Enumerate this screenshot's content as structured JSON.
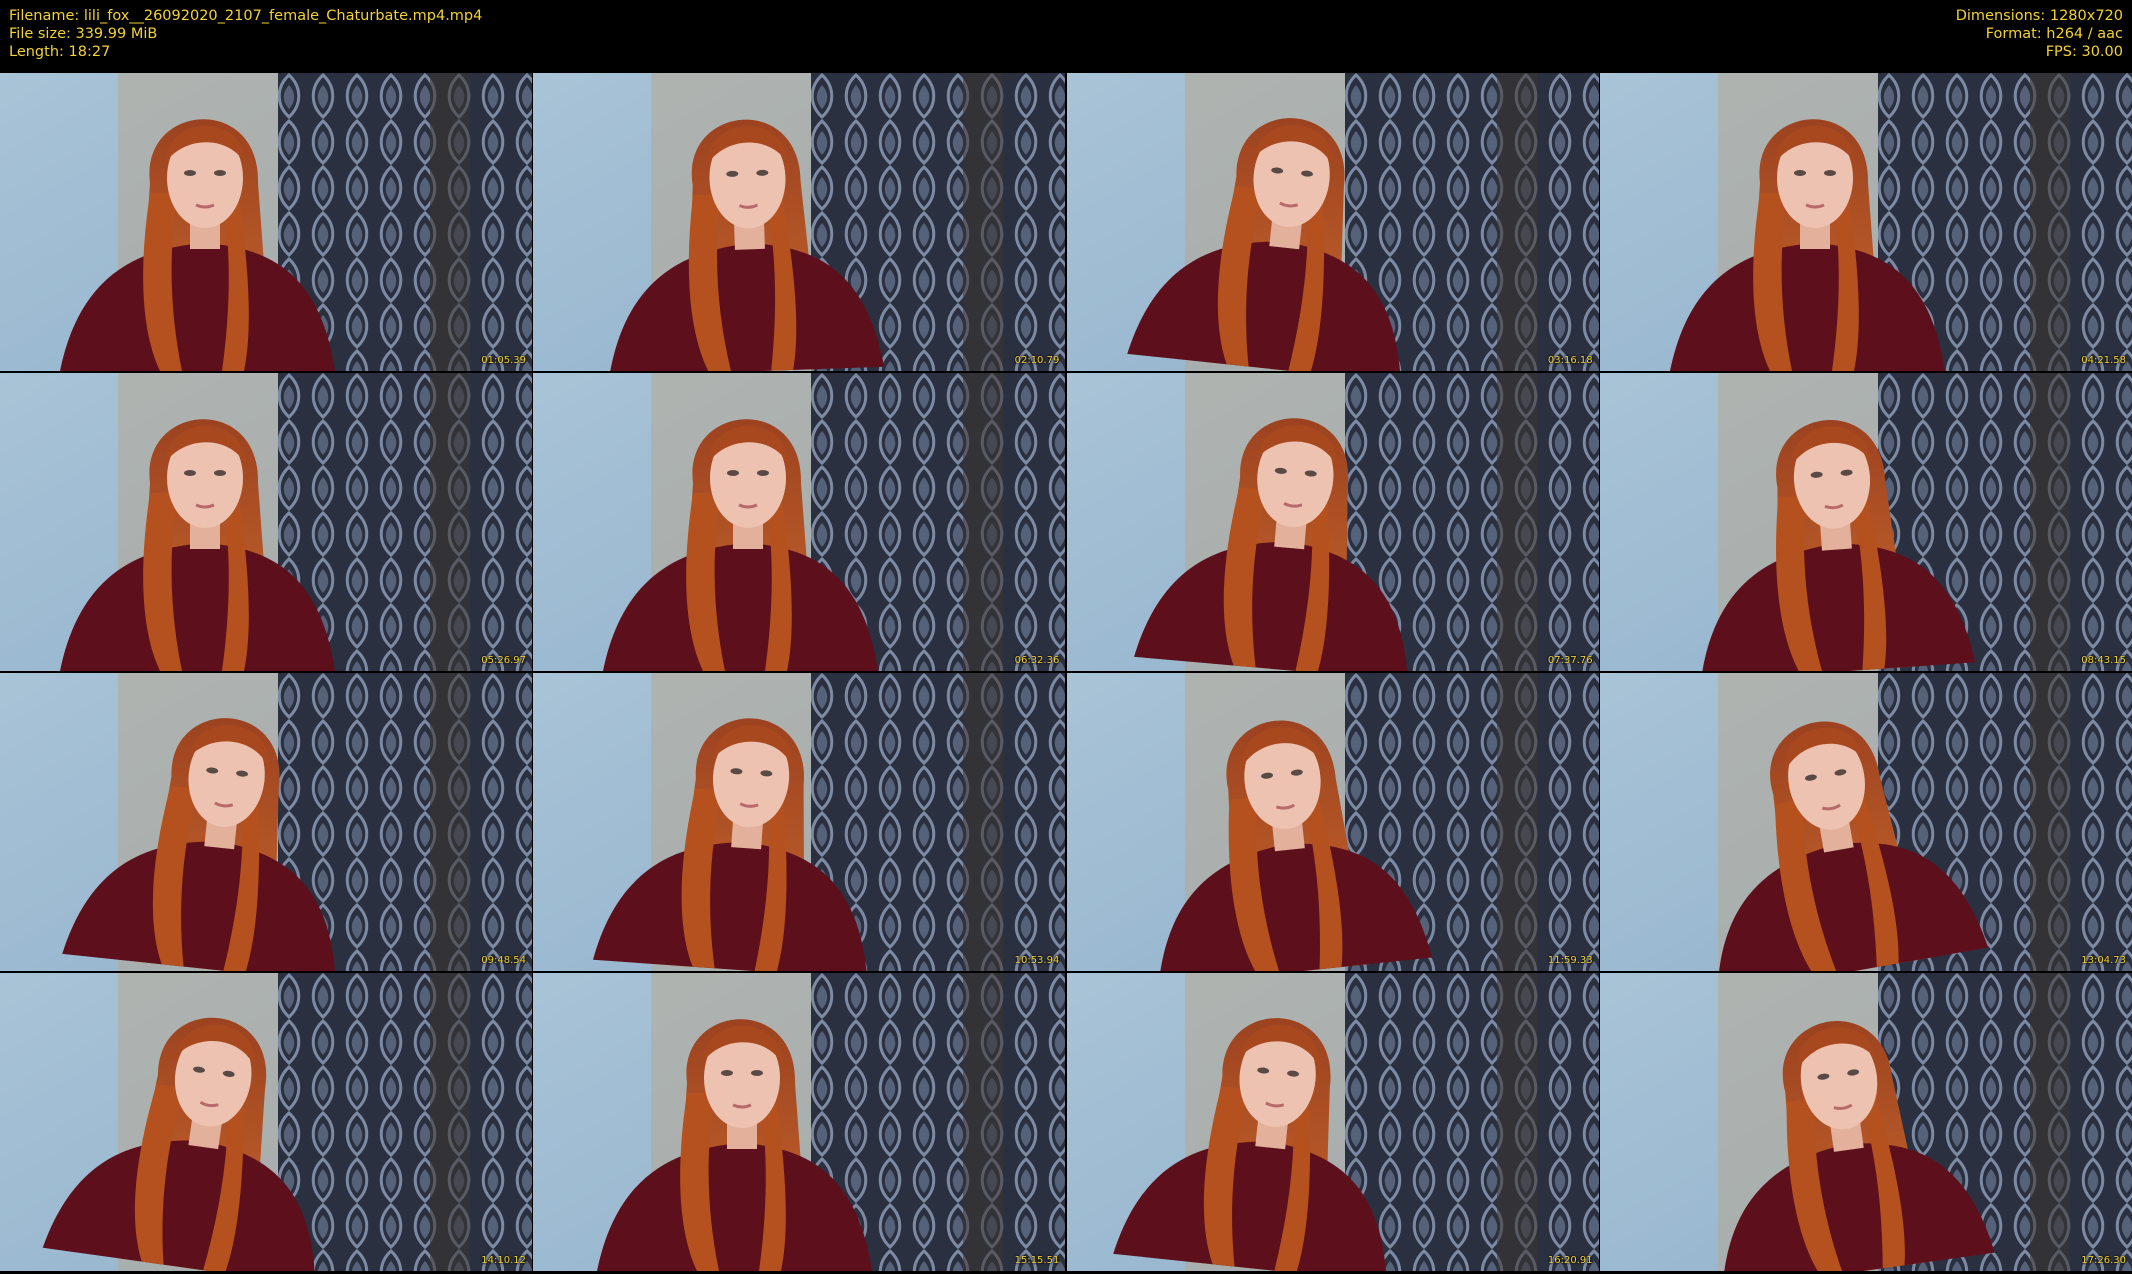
{
  "header": {
    "filename_label": "Filename: lili_fox__26092020_2107_female_Chaturbate.mp4.mp4",
    "filesize_label": "File size: 339.99 MiB",
    "length_label": "Length: 18:27",
    "dimensions_label": "Dimensions: 1280x720",
    "format_label": "Format: h264 / aac",
    "fps_label": "FPS: 30.00"
  },
  "thumbnails": [
    {
      "timestamp": "01:05.39"
    },
    {
      "timestamp": "02:10.79"
    },
    {
      "timestamp": "03:16.18"
    },
    {
      "timestamp": "04:21.58"
    },
    {
      "timestamp": "05:26.97"
    },
    {
      "timestamp": "06:32.36"
    },
    {
      "timestamp": "07:37.76"
    },
    {
      "timestamp": "08:43.15"
    },
    {
      "timestamp": "09:48.54"
    },
    {
      "timestamp": "10:53.94"
    },
    {
      "timestamp": "11:59.33"
    },
    {
      "timestamp": "13:04.73"
    },
    {
      "timestamp": "14:10.12"
    },
    {
      "timestamp": "15:15.51"
    },
    {
      "timestamp": "16:20.91"
    },
    {
      "timestamp": "17:26.30"
    }
  ],
  "colors": {
    "text": "#f2d234",
    "background": "#000000",
    "wall": "#8fb1cb",
    "curtain": "#2b3040",
    "hair": "#b8501f",
    "sweater": "#5e0f1c",
    "skin": "#eec2b0"
  }
}
